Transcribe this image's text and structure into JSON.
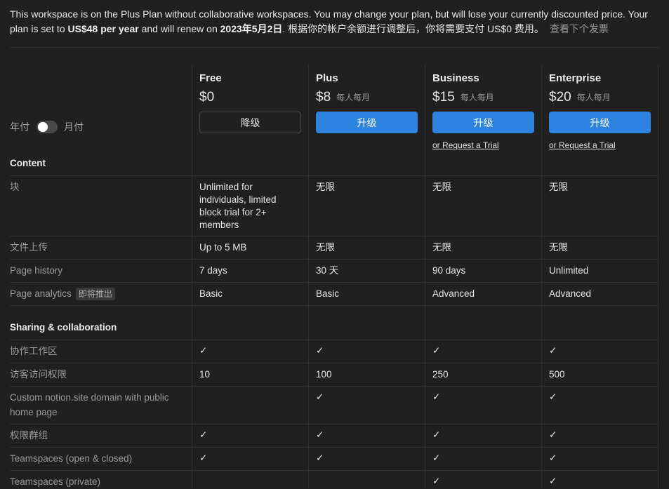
{
  "notice": {
    "text1": "This workspace is on the Plus Plan without collaborative workspaces. You may change your plan, but will lose your currently discounted price. Your plan is set to ",
    "price": "US$48 per year",
    "text2": " and will renew on ",
    "date": "2023年5月2日",
    "text3": ". 根据你的帐户余额进行调整后，你将需要支付 US$0 费用。",
    "invoice_link": "查看下个发票"
  },
  "billing_toggle": {
    "yearly": "年付",
    "monthly": "月付"
  },
  "plans": [
    {
      "name": "Free",
      "price": "$0",
      "per": "",
      "button": "降级",
      "trial": ""
    },
    {
      "name": "Plus",
      "price": "$8",
      "per": "每人每月",
      "button": "升级",
      "trial": ""
    },
    {
      "name": "Business",
      "price": "$15",
      "per": "每人每月",
      "button": "升级",
      "trial": "or Request a Trial"
    },
    {
      "name": "Enterprise",
      "price": "$20",
      "per": "每人每月",
      "button": "升级",
      "trial": "or Request a Trial"
    }
  ],
  "sections": {
    "content": "Content",
    "sharing": "Sharing & collaboration"
  },
  "check": "✓",
  "rows": {
    "blocks": {
      "label": "块",
      "values": [
        "Unlimited for individuals, limited block trial for 2+ members",
        "无限",
        "无限",
        "无限"
      ]
    },
    "uploads": {
      "label": "文件上传",
      "values": [
        "Up to 5 MB",
        "无限",
        "无限",
        "无限"
      ]
    },
    "history": {
      "label": "Page history",
      "values": [
        "7 days",
        "30 天",
        "90 days",
        "Unlimited"
      ]
    },
    "analytics": {
      "label": "Page analytics",
      "badge": "即将推出",
      "values": [
        "Basic",
        "Basic",
        "Advanced",
        "Advanced"
      ]
    },
    "collab_workspace": {
      "label": "协作工作区",
      "checks": [
        true,
        true,
        true,
        true
      ]
    },
    "guest_access": {
      "label": "访客访问权限",
      "values": [
        "10",
        "100",
        "250",
        "500"
      ]
    },
    "custom_domain": {
      "label": "Custom notion.site domain with public home page",
      "checks": [
        false,
        true,
        true,
        true
      ]
    },
    "permission_groups": {
      "label": "权限群组",
      "checks": [
        true,
        true,
        true,
        true
      ]
    },
    "teamspaces_open": {
      "label": "Teamspaces (open & closed)",
      "checks": [
        true,
        true,
        true,
        true
      ]
    },
    "teamspaces_private": {
      "label": "Teamspaces (private)",
      "checks": [
        false,
        false,
        true,
        true
      ]
    }
  }
}
